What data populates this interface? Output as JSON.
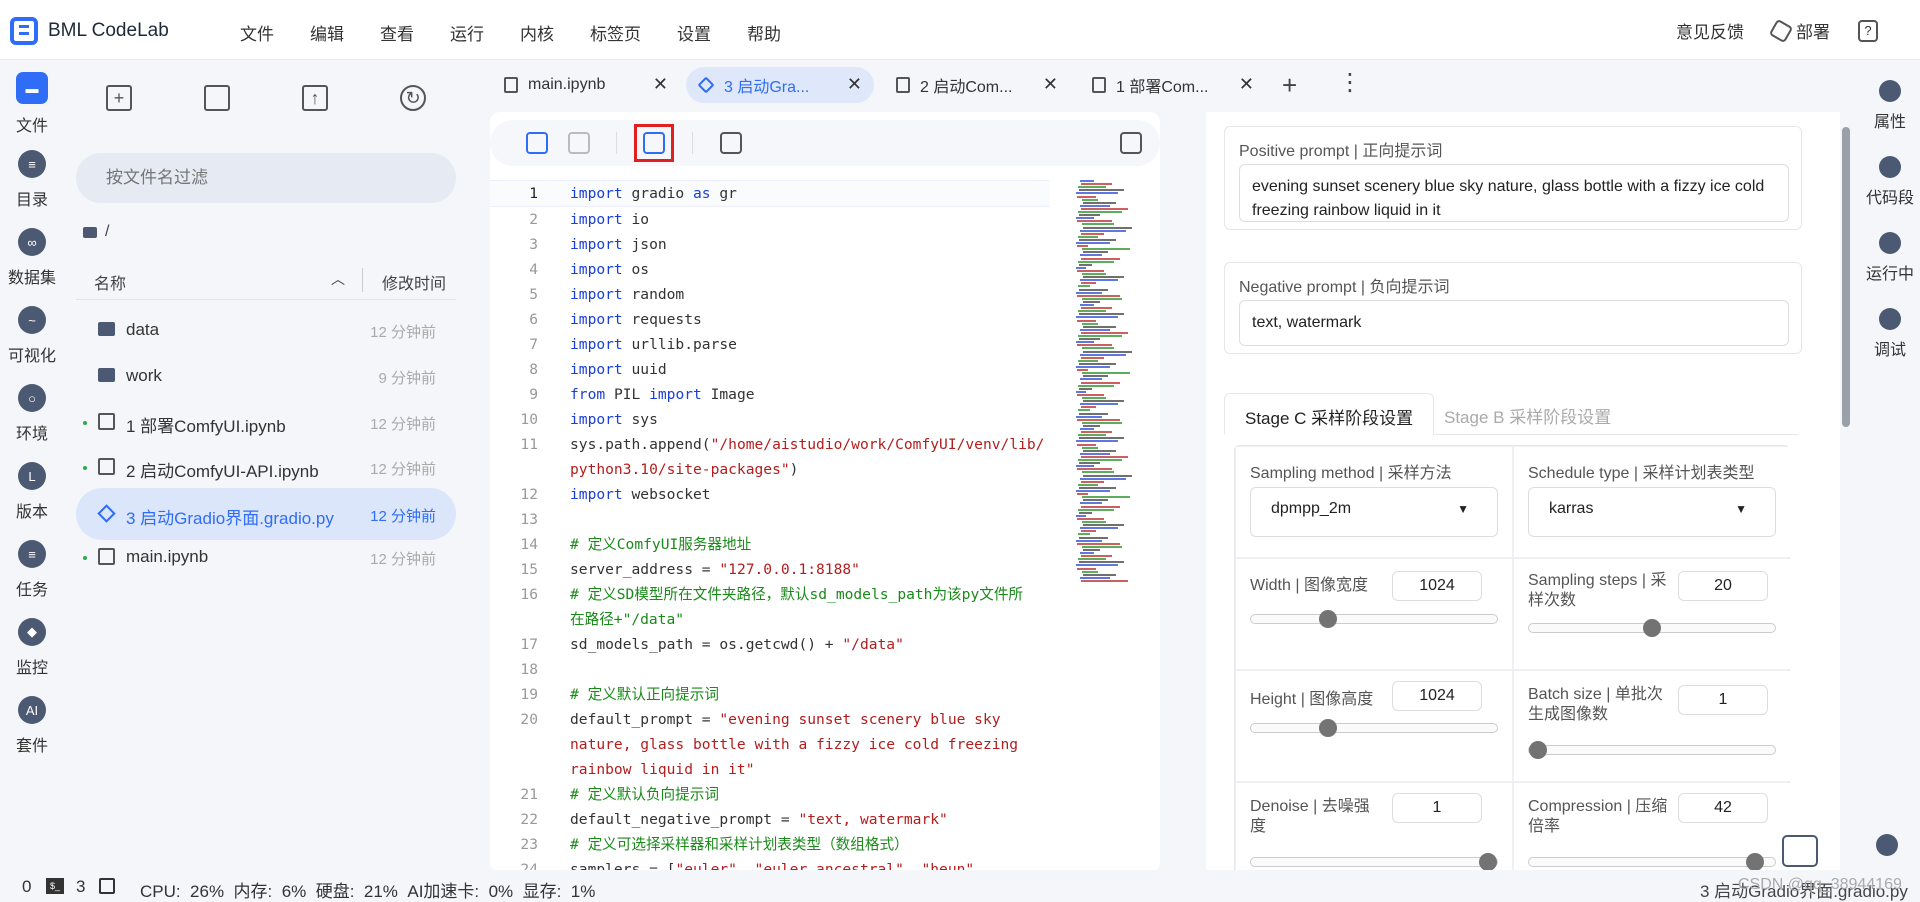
{
  "app": {
    "title": "BML CodeLab"
  },
  "menu": [
    "文件",
    "编辑",
    "查看",
    "运行",
    "内核",
    "标签页",
    "设置",
    "帮助"
  ],
  "top_right": {
    "feedback": "意见反馈",
    "deploy": "部署",
    "help": "?"
  },
  "left_nav": [
    "文件",
    "目录",
    "数据集",
    "可视化",
    "环境",
    "版本",
    "任务",
    "监控",
    "套件"
  ],
  "file_panel": {
    "filter_placeholder": "按文件名过滤",
    "path": "/",
    "col_name": "名称",
    "col_time": "修改时间",
    "files": [
      {
        "name": "data",
        "time": "12 分钟前",
        "type": "folder"
      },
      {
        "name": "work",
        "time": "9 分钟前",
        "type": "folder"
      },
      {
        "name": "1 部署ComfyUI.ipynb",
        "time": "12 分钟前",
        "type": "notebook"
      },
      {
        "name": "2 启动ComfyUI-API.ipynb",
        "time": "12 分钟前",
        "type": "notebook"
      },
      {
        "name": "3 启动Gradio界面.gradio.py",
        "time": "12 分钟前",
        "type": "gradio"
      },
      {
        "name": "main.ipynb",
        "time": "12 分钟前",
        "type": "notebook"
      }
    ]
  },
  "tabs": [
    {
      "label": "main.ipynb"
    },
    {
      "label": "3 启动Gra..."
    },
    {
      "label": "2 启动Com..."
    },
    {
      "label": "1 部署Com..."
    }
  ],
  "code": [
    {
      "n": "1",
      "html": "<span class='kw'>import</span> gradio <span class='kw'>as</span> gr"
    },
    {
      "n": "2",
      "html": "<span class='kw'>import</span> io"
    },
    {
      "n": "3",
      "html": "<span class='kw'>import</span> json"
    },
    {
      "n": "4",
      "html": "<span class='kw'>import</span> os"
    },
    {
      "n": "5",
      "html": "<span class='kw'>import</span> random"
    },
    {
      "n": "6",
      "html": "<span class='kw'>import</span> requests"
    },
    {
      "n": "7",
      "html": "<span class='kw'>import</span> urllib.parse"
    },
    {
      "n": "8",
      "html": "<span class='kw'>import</span> uuid"
    },
    {
      "n": "9",
      "html": "<span class='kw'>from</span> PIL <span class='kw'>import</span> Image"
    },
    {
      "n": "10",
      "html": "<span class='kw'>import</span> sys"
    },
    {
      "n": "11",
      "html": "sys.path.append(<span class='str'>\"/home/aistudio/work/ComfyUI/venv/lib/\npython3.10/site-packages\"</span>)"
    },
    {
      "n": "12",
      "html": "<span class='kw'>import</span> websocket"
    },
    {
      "n": "13",
      "html": ""
    },
    {
      "n": "14",
      "html": "<span class='cm'># 定义ComfyUI服务器地址</span>"
    },
    {
      "n": "15",
      "html": "server_address = <span class='str'>\"127.0.0.1:8188\"</span>"
    },
    {
      "n": "16",
      "html": "<span class='cm'># 定义SD模型所在文件夹路径，默认sd_models_path为该py文件所\n在路径+\"/data\"</span>"
    },
    {
      "n": "17",
      "html": "sd_models_path = os.getcwd() + <span class='str'>\"/data\"</span>"
    },
    {
      "n": "18",
      "html": ""
    },
    {
      "n": "19",
      "html": "<span class='cm'># 定义默认正向提示词</span>"
    },
    {
      "n": "20",
      "html": "default_prompt = <span class='str'>\"evening sunset scenery blue sky\nnature, glass bottle with a fizzy ice cold freezing\nrainbow liquid in it\"</span>"
    },
    {
      "n": "21",
      "html": "<span class='cm'># 定义默认负向提示词</span>"
    },
    {
      "n": "22",
      "html": "default_negative_prompt = <span class='str'>\"text, watermark\"</span>"
    },
    {
      "n": "23",
      "html": "<span class='cm'># 定义可选择采样器和采样计划表类型（数组格式）</span>"
    },
    {
      "n": "24",
      "html": "samplers = [<span class='str'>\"euler\"</span>, <span class='str'>\"euler_ancestral\"</span>, <span class='str'>\"heun\"</span>,"
    }
  ],
  "preview": {
    "positive_label": "Positive prompt | 正向提示词",
    "positive_value": "evening sunset scenery blue sky nature, glass bottle with a fizzy ice cold freezing rainbow liquid in it",
    "negative_label": "Negative prompt | 负向提示词",
    "negative_value": "text, watermark",
    "stage_c_tab": "Stage C 采样阶段设置",
    "stage_b_tab": "Stage B 采样阶段设置",
    "sampling_method_label": "Sampling method | 采样方法",
    "sampling_method_value": "dpmpp_2m",
    "schedule_type_label": "Schedule type | 采样计划表类型",
    "schedule_type_value": "karras",
    "width_label": "Width | 图像宽度",
    "width_value": "1024",
    "width_level": 0.3,
    "steps_label": "Sampling steps | 采样次数",
    "steps_value": "20",
    "steps_level": 0.5,
    "height_label": "Height | 图像高度",
    "height_value": "1024",
    "height_level": 0.3,
    "batch_label": "Batch size | 单批次生成图像数",
    "batch_value": "1",
    "batch_level": 0.0,
    "denoise_label": "Denoise | 去噪强度",
    "denoise_value": "1",
    "denoise_level": 1.0,
    "compression_label": "Compression | 压缩倍率",
    "compression_value": "42",
    "compression_level": 0.95
  },
  "right_nav": [
    "属性",
    "代码段",
    "运行中",
    "调试"
  ],
  "status": {
    "left_num": "0",
    "term_count": "3",
    "usage": "CPU:  26%  内存:  6%  硬盘:  21%  AI加速卡:  0%  显存:  1%",
    "current_file": "3 启动Gradio界面.gradio.py",
    "watermark": "CSDN @qq_38944169"
  }
}
